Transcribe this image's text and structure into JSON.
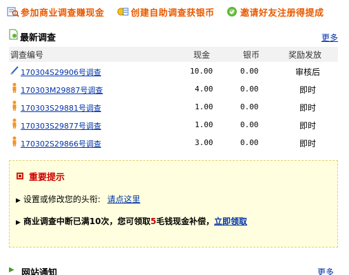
{
  "topnav": {
    "items": [
      {
        "label": "参加商业调查赚现金",
        "icon": "survey-icon"
      },
      {
        "label": "创建自助调查获银币",
        "icon": "create-survey-icon"
      },
      {
        "label": "邀请好友注册得提成",
        "icon": "invite-icon"
      }
    ]
  },
  "latest": {
    "title": "最新调查",
    "more": "更多",
    "columns": [
      "调查编号",
      "现金",
      "银币",
      "奖励发放"
    ],
    "rows": [
      {
        "id": "170304S29906号调查",
        "cash": "10.00",
        "coins": "0.00",
        "payout": "审核后",
        "icon": "pencil-icon"
      },
      {
        "id": "170303M29887号调查",
        "cash": "4.00",
        "coins": "0.00",
        "payout": "即时",
        "icon": "person-icon"
      },
      {
        "id": "170303S29881号调查",
        "cash": "1.00",
        "coins": "0.00",
        "payout": "即时",
        "icon": "person-icon"
      },
      {
        "id": "170303S29877号调查",
        "cash": "1.00",
        "coins": "0.00",
        "payout": "即时",
        "icon": "person-icon"
      },
      {
        "id": "170302S29866号调查",
        "cash": "3.00",
        "coins": "0.00",
        "payout": "即时",
        "icon": "person-icon"
      }
    ]
  },
  "notice": {
    "title": "重要提示",
    "line1_text": "设置或修改您的头衔:",
    "line1_link": "请点这里",
    "line2_a": "商业调查中断已满10次，您可领取",
    "line2_num": "5",
    "line2_b": "毛钱现金补偿，",
    "line2_link": "立即领取"
  },
  "site_notice": {
    "title": "网站通知",
    "more": "更多"
  },
  "colors": {
    "nav_orange": "#e85a00",
    "link_blue": "#0033aa",
    "notice_bg": "#ffffdf",
    "accent_red": "#cc0000"
  }
}
